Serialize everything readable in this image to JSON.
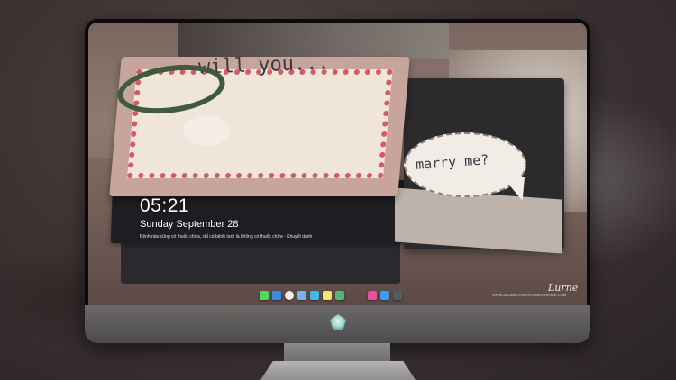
{
  "lock_screen": {
    "time": "05:21",
    "date": "Sunday September  28",
    "quote": "Bệnh nào cũng có thuốc chữa, chỉ có bệnh lười là không có thuốc chữa - Khuyết danh"
  },
  "wallpaper": {
    "lid_text": "will you...",
    "bubble_text": "marry me?",
    "signature": "Lurne",
    "watermark": "WWW.ALLWALLPAPERSBIBOSHEHEK.COM"
  },
  "dock": {
    "apps": [
      {
        "name": "messages-icon",
        "color": "#4cd964"
      },
      {
        "name": "finder-icon",
        "color": "#3c8be0"
      },
      {
        "name": "clock-icon",
        "color": "#f2f2f2"
      },
      {
        "name": "preview-icon",
        "color": "#7bb2e6"
      },
      {
        "name": "video-icon",
        "color": "#45b6e8"
      },
      {
        "name": "notes-icon",
        "color": "#f9e27a"
      },
      {
        "name": "photo-icon",
        "color": "#58b57a"
      },
      {
        "name": "itunes-icon",
        "color": "#e94fa1"
      },
      {
        "name": "appstore-icon",
        "color": "#3c9ef2"
      },
      {
        "name": "camera-icon",
        "color": "#555a60"
      }
    ]
  }
}
